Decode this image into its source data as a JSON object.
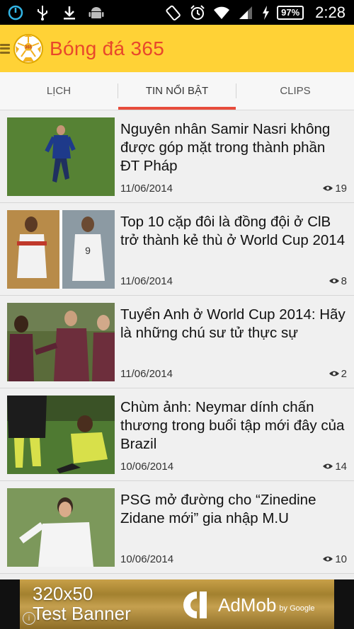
{
  "status_bar": {
    "icons_left": [
      "power-icon",
      "usb-icon",
      "download-icon",
      "android-icon"
    ],
    "icons_right": [
      "rotate-icon",
      "alarm-icon",
      "wifi-icon",
      "signal-icon",
      "charging-icon"
    ],
    "battery": "97%",
    "time": "2:28"
  },
  "app_bar": {
    "title": "Bóng đá 365",
    "logo_text": "365",
    "colors": {
      "background": "#ffd236",
      "title": "#e8472b"
    }
  },
  "tabs": [
    {
      "label": "LỊCH",
      "active": false
    },
    {
      "label": "TIN NỔI BẬT",
      "active": true
    },
    {
      "label": "CLIPS",
      "active": false
    }
  ],
  "articles": [
    {
      "title": "Nguyên nhân Samir Nasri không được góp mặt trong thành phần ĐT Pháp",
      "date": "11/06/2014",
      "views": "19"
    },
    {
      "title": "Top 10 cặp đôi là  đồng  đội ở ClB  trở thành kẻ thù ở World Cup 2014",
      "date": "11/06/2014",
      "views": "8"
    },
    {
      "title": "Tuyển Anh ở World Cup 2014: Hãy là những  chú  sư  tử  thực sự",
      "date": "11/06/2014",
      "views": "2"
    },
    {
      "title": "Chùm ảnh: Neymar dính chấn thương trong buổi tập mới đây của Brazil",
      "date": "10/06/2014",
      "views": "14"
    },
    {
      "title": "PSG mở đường cho “Zinedine Zidane  mới” gia nhập M.U",
      "date": "10/06/2014",
      "views": "10"
    }
  ],
  "ad": {
    "line1": "320x50",
    "line2": "Test Banner",
    "brand": "AdMob",
    "by": "by Google",
    "info": "i"
  }
}
